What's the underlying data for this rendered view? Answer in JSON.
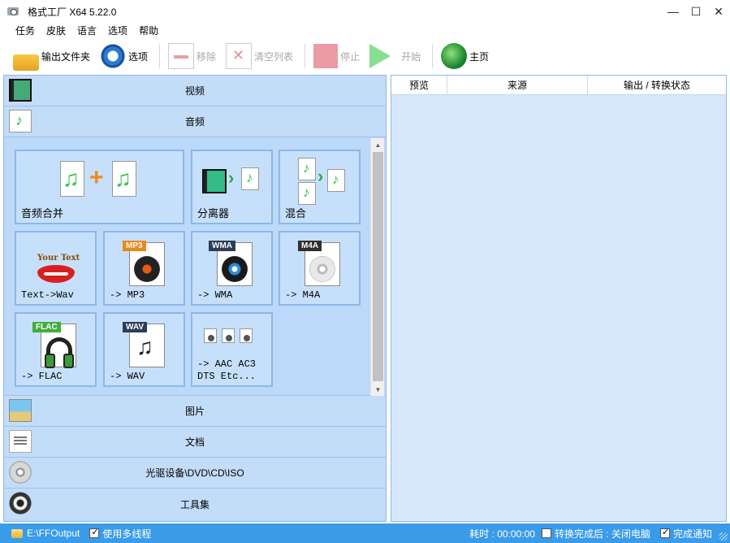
{
  "window": {
    "title": "格式工厂 X64 5.22.0"
  },
  "menu": [
    "任务",
    "皮肤",
    "语言",
    "选项",
    "帮助"
  ],
  "toolbar": {
    "output_folder": "输出文件夹",
    "options": "选项",
    "remove": "移除",
    "clear_list": "清空列表",
    "stop": "停止",
    "start": "开始",
    "home": "主页"
  },
  "categories": {
    "video": "视频",
    "audio": "音频",
    "picture": "图片",
    "document": "文档",
    "disc": "光驱设备\\DVD\\CD\\ISO",
    "tools": "工具集"
  },
  "audio_tiles": {
    "merge": "音频合并",
    "splitter": "分离器",
    "mix": "混合",
    "text_to_wav": "Text->Wav",
    "your_text": "Your Text",
    "mp3": "-> MP3",
    "wma": "-> WMA",
    "m4a": "-> M4A",
    "flac": "-> FLAC",
    "wav": "-> WAV",
    "others_line1": "-> AAC AC3",
    "others_line2": "DTS Etc..."
  },
  "badges": {
    "mp3": "MP3",
    "wma": "WMA",
    "m4a": "M4A",
    "flac": "FLAC",
    "wav": "WAV"
  },
  "task_grid": {
    "columns": [
      "预览",
      "来源",
      "输出 / 转换状态"
    ]
  },
  "status": {
    "output_path": "E:\\FFOutput",
    "multithread_label": "使用多线程",
    "multithread_checked": true,
    "elapsed": "耗时 : 00:00:00",
    "shutdown_label": "转换完成后 : 关闭电脑",
    "shutdown_checked": false,
    "notify_label": "完成通知",
    "notify_checked": true
  },
  "colors": {
    "statusbar": "#3a9be8",
    "panel": "#bcd9f9",
    "grid": "#d8e8fb"
  }
}
